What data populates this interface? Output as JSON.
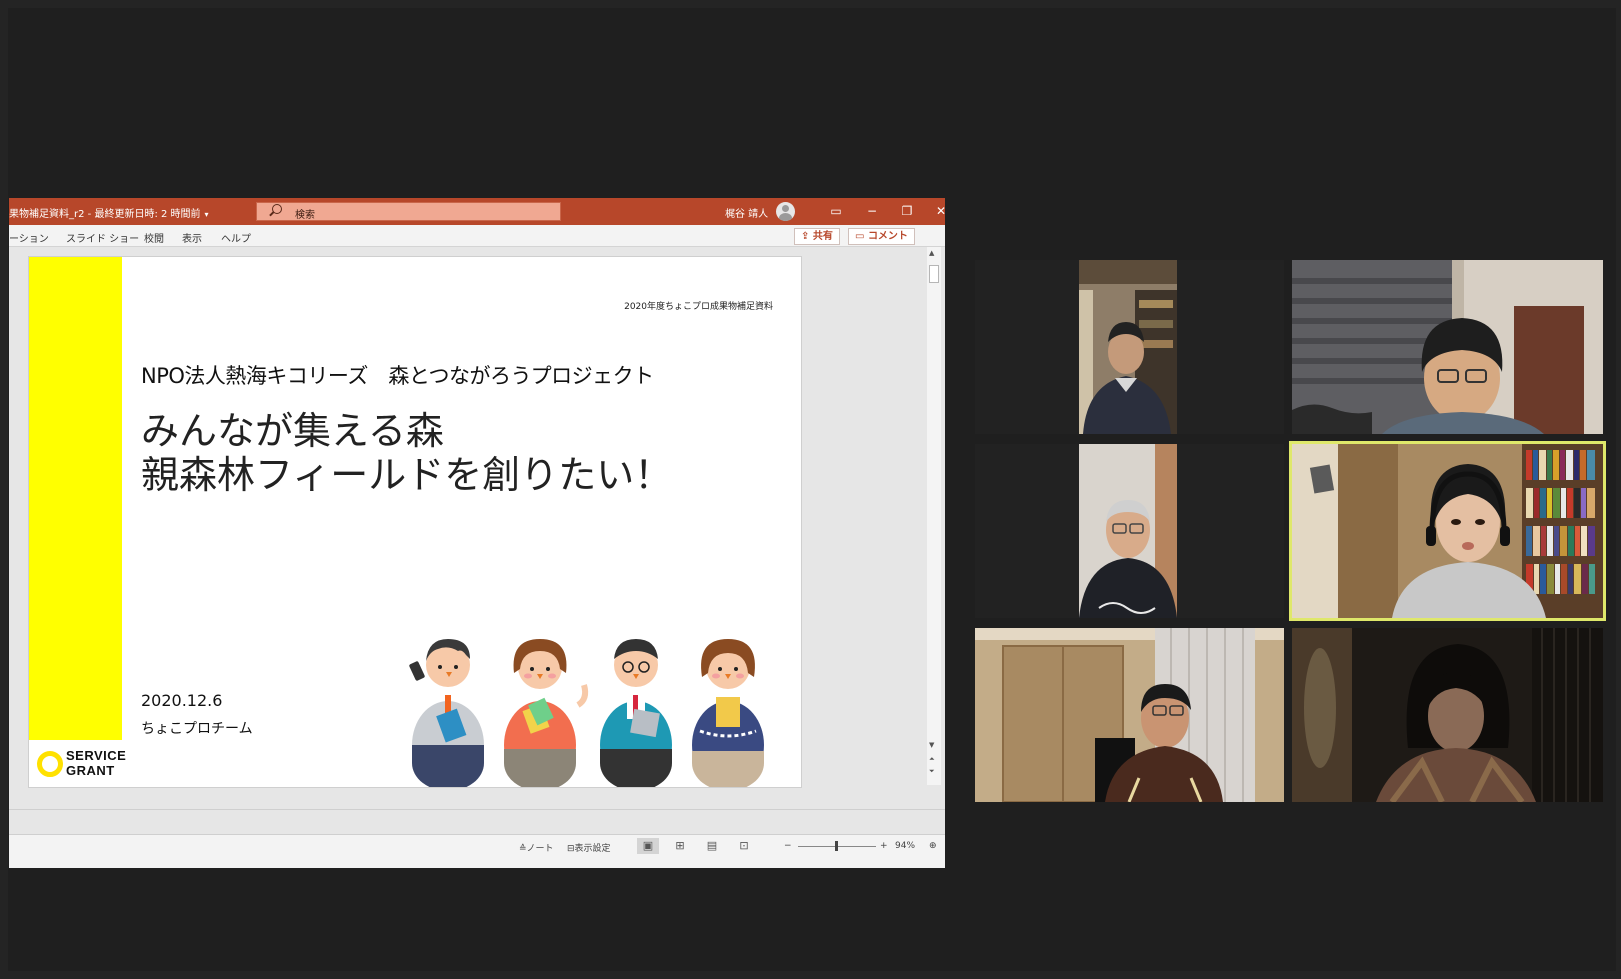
{
  "ppt": {
    "doc_title": "果物補足資料_r2 - 最終更新日時: 2 時間前",
    "search_placeholder": "検索",
    "user_name": "梶谷 靖人",
    "menu": [
      "ーション",
      "スライド ショー",
      "校閲",
      "表示",
      "ヘルプ"
    ],
    "share_label": "共有",
    "comment_label": "コメント",
    "window_controls": {
      "ribbon": "ribbon-display-icon",
      "minimize": "minimize-icon",
      "restore": "restore-icon",
      "close": "close-icon"
    }
  },
  "slide": {
    "header_note": "2020年度ちょこプロ成果物補足資料",
    "subtitle": "NPO法人熱海キコリーズ　森とつながろうプロジェクト",
    "title_line1": "みんなが集える森",
    "title_line2": "親森林フィールドを創りたい！",
    "date": "2020.12.6",
    "team": "ちょこプロチーム",
    "logo_line1": "SERVICE",
    "logo_line2": "GRANT",
    "accent_color": "#ffff00"
  },
  "status": {
    "notes_label": "ノート",
    "display_settings_label": "表示設定",
    "zoom_minus": "−",
    "zoom_plus": "+",
    "zoom_level": "94%"
  },
  "participants": [
    {
      "id": "p1",
      "active": false
    },
    {
      "id": "p2",
      "active": false
    },
    {
      "id": "p3",
      "active": false
    },
    {
      "id": "p4",
      "active": true,
      "highlight_color": "#dfe86a"
    },
    {
      "id": "p5",
      "active": false
    },
    {
      "id": "p6",
      "active": false
    }
  ]
}
